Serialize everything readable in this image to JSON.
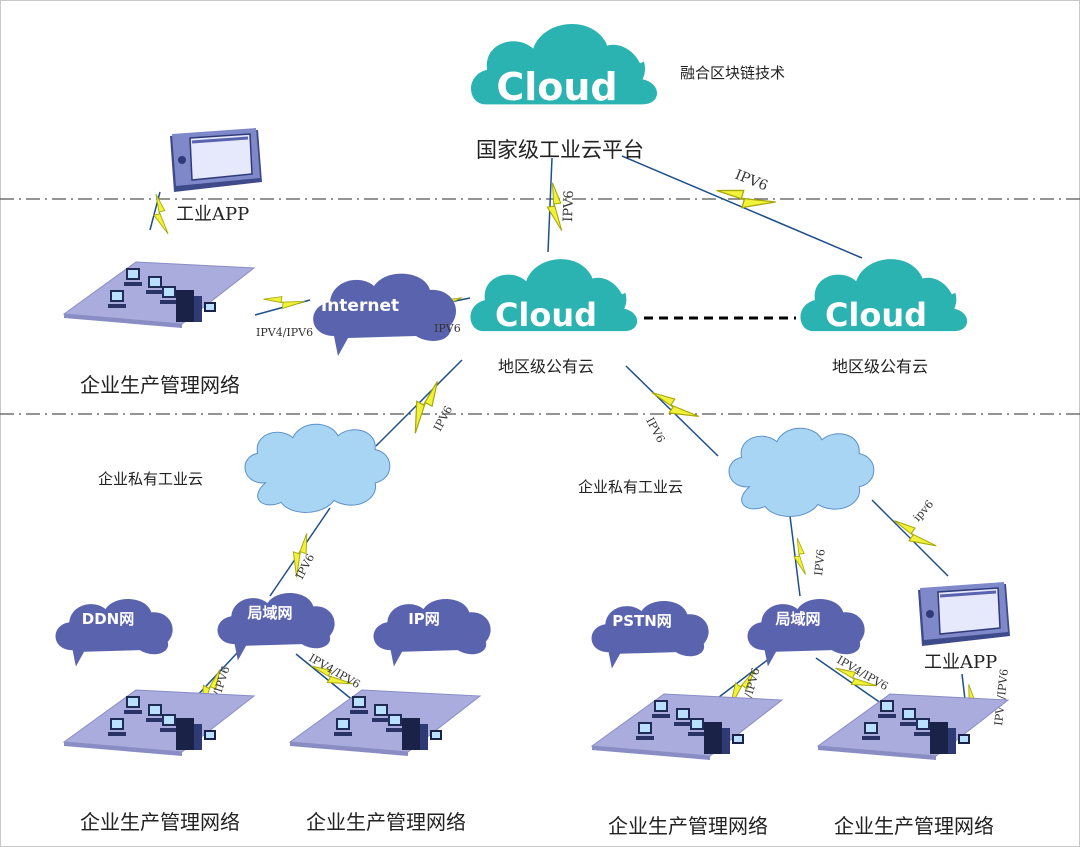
{
  "top": {
    "cloud_text": "Cloud",
    "platform_label": "国家级工业云平台",
    "blockchain_note": "融合区块链技术"
  },
  "regional": {
    "left_cloud_text": "Cloud",
    "right_cloud_text": "Cloud",
    "left_label": "地区级公有云",
    "right_label": "地区级公有云",
    "internet": "Internet"
  },
  "app": {
    "top_label": "工业APP",
    "bottom_label": "工业APP"
  },
  "private": {
    "left_label": "企业私有工业云",
    "right_label": "企业私有工业云"
  },
  "small_clouds": {
    "ddn": "DDN网",
    "lan_left": "局域网",
    "ip": "IP网",
    "pstn": "PSTN网",
    "lan_right": "局域网"
  },
  "networks": {
    "top_left": "企业生产管理网络",
    "bottom_1": "企业生产管理网络",
    "bottom_2": "企业生产管理网络",
    "bottom_3": "企业生产管理网络",
    "bottom_4": "企业生产管理网络"
  },
  "links": {
    "ipv6": "IPV6",
    "ipv6_lower": "ipv6",
    "ipv4_ipv6": "IPV4/IPV6"
  },
  "colors": {
    "teal": "#2ab3b0",
    "purple_cloud": "#5a63ad",
    "blue_cloud": "#a7d5f3",
    "lightning": "#f1f23a",
    "platform": "#a9acdc"
  }
}
